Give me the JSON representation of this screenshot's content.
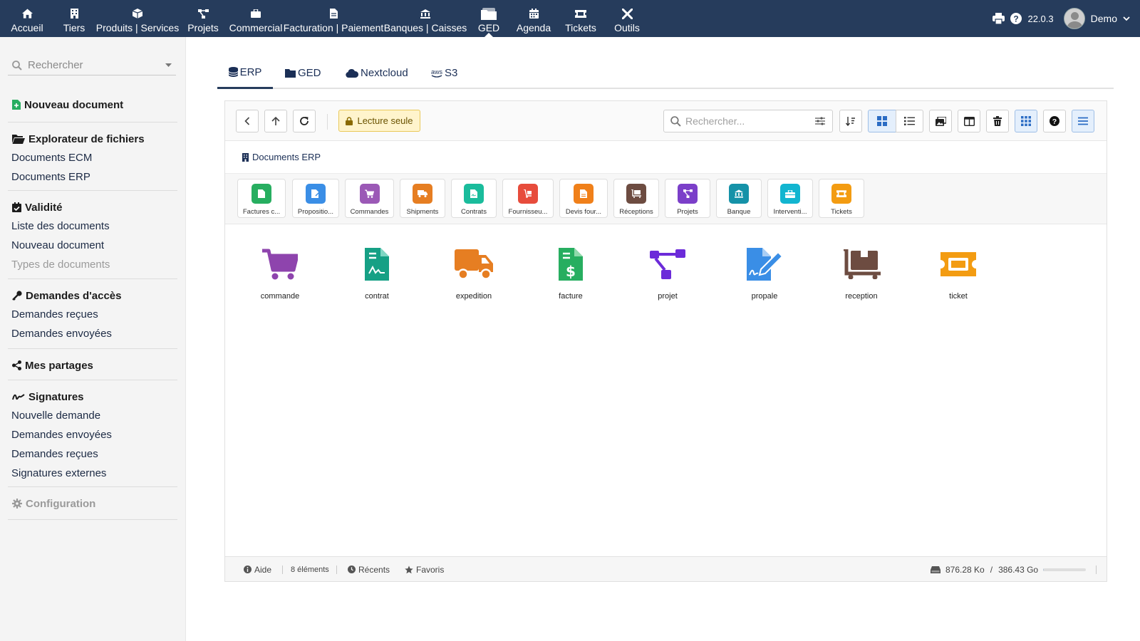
{
  "topbar": {
    "menu": [
      {
        "label": "Accueil",
        "icon": "home-icon"
      },
      {
        "label": "Tiers",
        "icon": "building-icon"
      },
      {
        "label": "Produits | Services",
        "icon": "cube-icon"
      },
      {
        "label": "Projets",
        "icon": "sitemap-icon"
      },
      {
        "label": "Commercial",
        "icon": "suitcase-icon"
      },
      {
        "label": "Facturation | Paiement",
        "icon": "file-invoice-icon"
      },
      {
        "label": "Banques | Caisses",
        "icon": "bank-icon"
      },
      {
        "label": "GED",
        "icon": "folder-stack-icon",
        "active": true
      },
      {
        "label": "Agenda",
        "icon": "calendar-icon"
      },
      {
        "label": "Tickets",
        "icon": "ticket-icon"
      },
      {
        "label": "Outils",
        "icon": "tools-icon"
      }
    ],
    "version": "22.0.3",
    "user": "Demo"
  },
  "sidebar": {
    "search_placeholder": "Rechercher",
    "new_document": "Nouveau document",
    "explorer": {
      "title": "Explorateur de fichiers",
      "items": [
        "Documents ECM",
        "Documents ERP"
      ]
    },
    "validity": {
      "title": "Validité",
      "items": [
        "Liste des documents",
        "Nouveau document"
      ],
      "muted_item": "Types de documents"
    },
    "access": {
      "title": "Demandes d'accès",
      "items": [
        "Demandes reçues",
        "Demandes envoyées"
      ]
    },
    "shares": {
      "title": "Mes partages"
    },
    "signatures": {
      "title": "Signatures",
      "items": [
        "Nouvelle demande",
        "Demandes envoyées",
        "Demandes reçues",
        "Signatures externes"
      ]
    },
    "configuration": {
      "title": "Configuration"
    }
  },
  "tabs": [
    {
      "label": "ERP",
      "icon": "database-icon",
      "active": true
    },
    {
      "label": "GED",
      "icon": "folder-icon"
    },
    {
      "label": "Nextcloud",
      "icon": "cloud-icon"
    },
    {
      "label": "S3",
      "icon": "aws-icon",
      "prefix": "aws"
    }
  ],
  "toolbar": {
    "readonly_label": "Lecture seule",
    "search_placeholder": "Rechercher..."
  },
  "breadcrumb": {
    "label": "Documents ERP"
  },
  "shortcuts": [
    {
      "label": "Factures c...",
      "color": "#27ae60"
    },
    {
      "label": "Propositio...",
      "color": "#3a8ee6"
    },
    {
      "label": "Commandes",
      "color": "#9b59b6"
    },
    {
      "label": "Shipments",
      "color": "#e67e22"
    },
    {
      "label": "Contrats",
      "color": "#1abc9c"
    },
    {
      "label": "Fournisseu...",
      "color": "#e74c3c"
    },
    {
      "label": "Devis four...",
      "color": "#f0801a"
    },
    {
      "label": "Réceptions",
      "color": "#6d4c41"
    },
    {
      "label": "Projets",
      "color": "#7b3fc9"
    },
    {
      "label": "Banque",
      "color": "#1592a8"
    },
    {
      "label": "Interventi...",
      "color": "#12b5d0"
    },
    {
      "label": "Tickets",
      "color": "#f39c12"
    }
  ],
  "folders": [
    {
      "label": "commande",
      "color": "#8e44ad"
    },
    {
      "label": "contrat",
      "color": "#16a085"
    },
    {
      "label": "expedition",
      "color": "#e67e22"
    },
    {
      "label": "facture",
      "color": "#27ae60"
    },
    {
      "label": "projet",
      "color": "#6c2bd9"
    },
    {
      "label": "propale",
      "color": "#3a8ee6"
    },
    {
      "label": "reception",
      "color": "#6d4c41"
    },
    {
      "label": "ticket",
      "color": "#f39c12"
    }
  ],
  "statusbar": {
    "help": "Aide",
    "count": "8 éléments",
    "recent": "Récents",
    "favorites": "Favoris",
    "used": "876.28 Ko",
    "slash": "/",
    "total": "386.43 Go",
    "quota_fraction": 0.002
  }
}
